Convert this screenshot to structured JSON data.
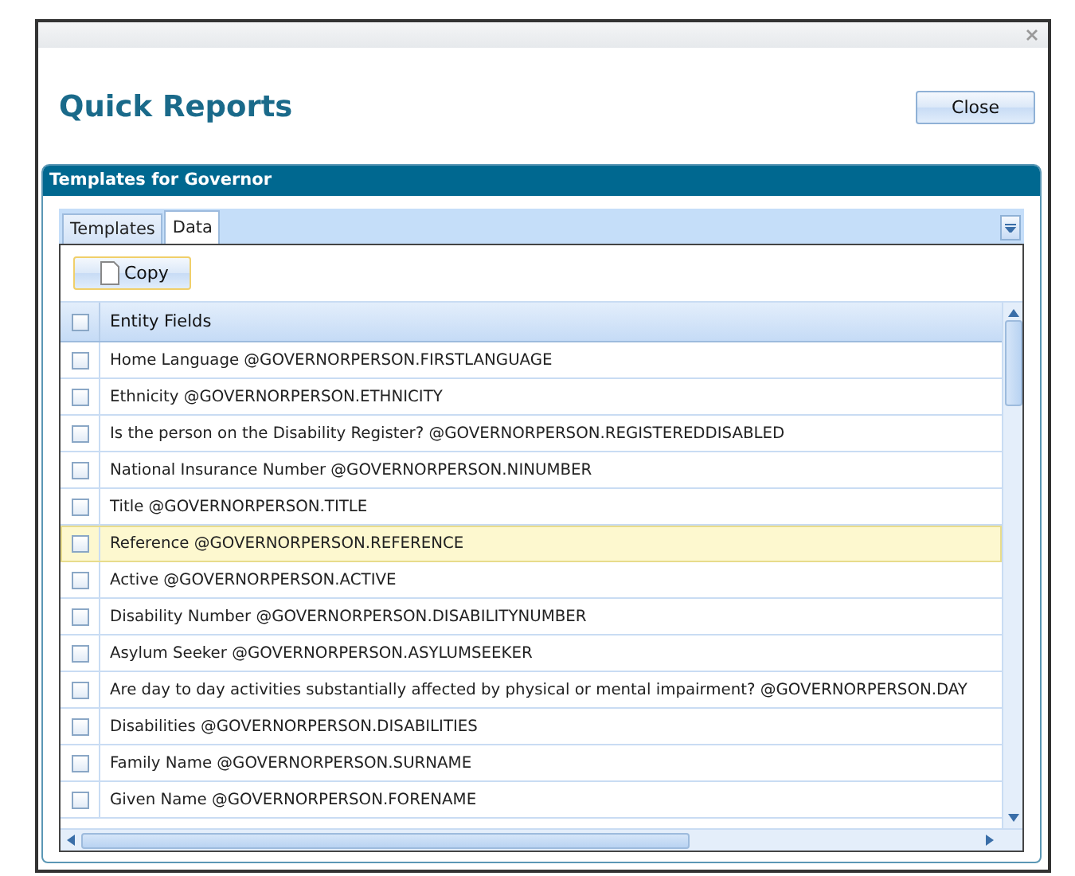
{
  "window": {
    "title": "Quick Reports",
    "close_button": "Close"
  },
  "panel": {
    "title": "Templates for Governor"
  },
  "tabs": [
    {
      "label": "Templates",
      "selected": false
    },
    {
      "label": "Data",
      "selected": true
    }
  ],
  "toolbar": {
    "copy_button": "Copy"
  },
  "grid": {
    "header": {
      "label": "Entity Fields",
      "checked": false
    },
    "rows": [
      {
        "label": "Home Language @GOVERNORPERSON.FIRSTLANGUAGE",
        "checked": false,
        "selected": false
      },
      {
        "label": "Ethnicity @GOVERNORPERSON.ETHNICITY",
        "checked": false,
        "selected": false
      },
      {
        "label": "Is the person on the Disability Register? @GOVERNORPERSON.REGISTEREDDISABLED",
        "checked": false,
        "selected": false
      },
      {
        "label": "National Insurance Number @GOVERNORPERSON.NINUMBER",
        "checked": false,
        "selected": false
      },
      {
        "label": "Title @GOVERNORPERSON.TITLE",
        "checked": false,
        "selected": false
      },
      {
        "label": "Reference @GOVERNORPERSON.REFERENCE",
        "checked": false,
        "selected": true
      },
      {
        "label": "Active @GOVERNORPERSON.ACTIVE",
        "checked": false,
        "selected": false
      },
      {
        "label": "Disability Number @GOVERNORPERSON.DISABILITYNUMBER",
        "checked": false,
        "selected": false
      },
      {
        "label": "Asylum Seeker @GOVERNORPERSON.ASYLUMSEEKER",
        "checked": false,
        "selected": false
      },
      {
        "label": "Are day to day activities substantially affected by physical or mental impairment? @GOVERNORPERSON.DAY",
        "checked": false,
        "selected": false
      },
      {
        "label": "Disabilities @GOVERNORPERSON.DISABILITIES",
        "checked": false,
        "selected": false
      },
      {
        "label": "Family Name @GOVERNORPERSON.SURNAME",
        "checked": false,
        "selected": false
      },
      {
        "label": "Given Name @GOVERNORPERSON.FORENAME",
        "checked": false,
        "selected": false
      }
    ]
  }
}
